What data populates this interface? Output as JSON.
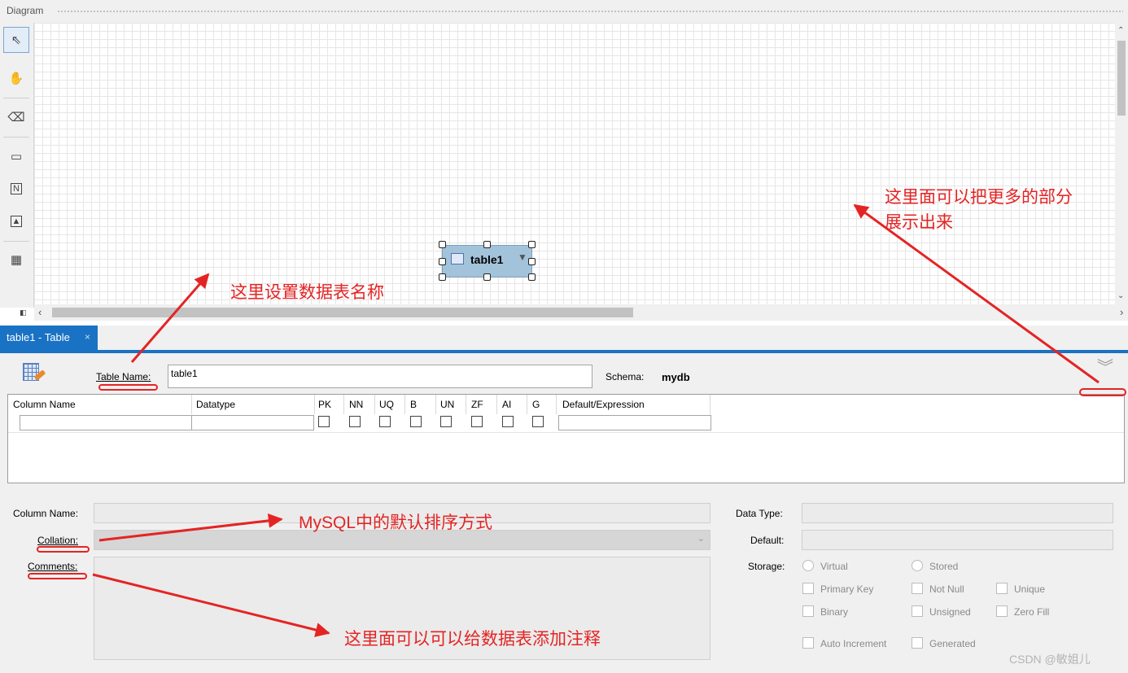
{
  "diagram": {
    "title": "Diagram",
    "tools": [
      {
        "name": "select-tool",
        "icon": "pointer-icon",
        "glyph": "⇖"
      },
      {
        "name": "hand-tool",
        "icon": "hand-icon",
        "glyph": "✋"
      },
      {
        "name": "eraser-tool",
        "icon": "eraser-icon",
        "glyph": "⌫"
      },
      {
        "name": "layer-tool",
        "icon": "layer-icon",
        "glyph": "▭"
      },
      {
        "name": "note-tool",
        "icon": "note-icon",
        "glyph": "N"
      },
      {
        "name": "image-tool",
        "icon": "image-icon",
        "glyph": "▲"
      },
      {
        "name": "table-tool",
        "icon": "table-icon",
        "glyph": "▦"
      }
    ],
    "table_figure": {
      "label": "table1"
    }
  },
  "tab": {
    "label": "table1 - Table",
    "close": "×"
  },
  "editor": {
    "table_name_label": "Table Name:",
    "table_name_value": "table1",
    "schema_label": "Schema:",
    "schema_value": "mydb",
    "columns": [
      "Column Name",
      "Datatype",
      "PK",
      "NN",
      "UQ",
      "B",
      "UN",
      "ZF",
      "AI",
      "G",
      "Default/Expression"
    ],
    "details": {
      "column_name_label": "Column Name:",
      "collation_label": "Collation:",
      "comments_label": "Comments:",
      "data_type_label": "Data Type:",
      "default_label": "Default:",
      "storage_label": "Storage:",
      "storage_options": [
        "Virtual",
        "Stored"
      ],
      "flags": [
        "Primary Key",
        "Not Null",
        "Unique",
        "Binary",
        "Unsigned",
        "Zero Fill",
        "Auto Increment",
        "Generated"
      ]
    }
  },
  "annotations": {
    "set_name": "这里设置数据表名称",
    "expand_more": "这里面可以把更多的部分展示出来",
    "expand_more_line1": "这里面可以把更多的部分",
    "expand_more_line2": "展示出来",
    "collation": "MySQL中的默认排序方式",
    "comments": "这里面可以可以给数据表添加注释",
    "color": "#e42424"
  },
  "watermark": "CSDN @敏姐儿"
}
